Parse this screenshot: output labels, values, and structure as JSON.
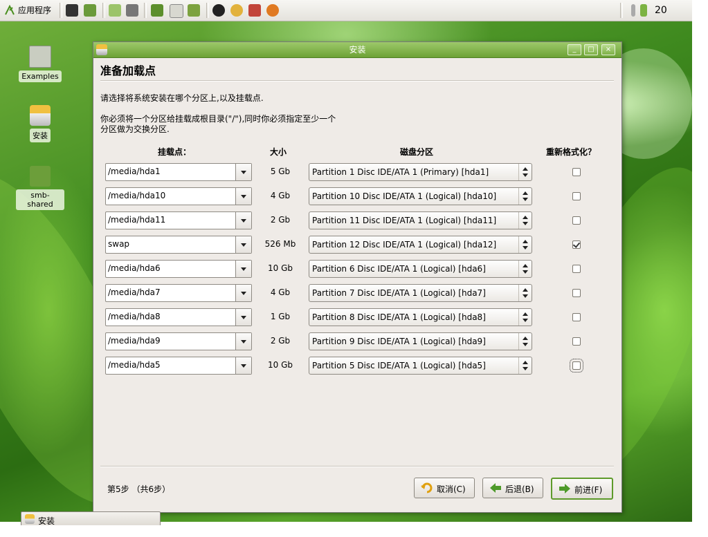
{
  "panel": {
    "apps_label": "应用程序",
    "clock": "20",
    "icons": [
      "terminal-icon",
      "folder-icon",
      "music-icon",
      "printer-icon",
      "network-icon",
      "editor-icon",
      "book-icon",
      "qq-icon",
      "chat-icon",
      "star-icon",
      "firefox-icon"
    ]
  },
  "desktop": {
    "icons": [
      {
        "label": "Examples"
      },
      {
        "label": "安装"
      },
      {
        "label": "smb-shared"
      }
    ]
  },
  "window": {
    "title": "安装",
    "heading": "准备加载点",
    "intro": "请选择将系统安装在哪个分区上,以及挂载点.",
    "note_line1": "你必须将一个分区给挂载成根目录(\"/\"),同时你必须指定至少一个",
    "note_line2": "分区做为交换分区.",
    "columns": {
      "mount": "挂载点：",
      "size": "大小",
      "partition": "磁盘分区",
      "reformat": "重新格式化？"
    },
    "rows": [
      {
        "mount": "/media/hda1",
        "size": "5 Gb",
        "partition": "Partition 1 Disc IDE/ATA 1 (Primary) [hda1]",
        "reformat": false
      },
      {
        "mount": "/media/hda10",
        "size": "4 Gb",
        "partition": "Partition 10 Disc IDE/ATA 1 (Logical) [hda10]",
        "reformat": false
      },
      {
        "mount": "/media/hda11",
        "size": "2 Gb",
        "partition": "Partition 11 Disc IDE/ATA 1 (Logical) [hda11]",
        "reformat": false
      },
      {
        "mount": "swap",
        "size": "526 Mb",
        "partition": "Partition 12 Disc IDE/ATA 1 (Logical) [hda12]",
        "reformat": true
      },
      {
        "mount": "/media/hda6",
        "size": "10 Gb",
        "partition": "Partition 6 Disc IDE/ATA 1 (Logical) [hda6]",
        "reformat": false
      },
      {
        "mount": "/media/hda7",
        "size": "4 Gb",
        "partition": "Partition 7 Disc IDE/ATA 1 (Logical) [hda7]",
        "reformat": false
      },
      {
        "mount": "/media/hda8",
        "size": "1 Gb",
        "partition": "Partition 8 Disc IDE/ATA 1 (Logical) [hda8]",
        "reformat": false
      },
      {
        "mount": "/media/hda9",
        "size": "2 Gb",
        "partition": "Partition 9 Disc IDE/ATA 1 (Logical) [hda9]",
        "reformat": false
      },
      {
        "mount": "/media/hda5",
        "size": "10 Gb",
        "partition": "Partition 5 Disc IDE/ATA 1 (Logical) [hda5]",
        "reformat": false
      }
    ],
    "step": "第5步 （共6步）",
    "buttons": {
      "cancel": "取消(C)",
      "back": "后退(B)",
      "forward": "前进(F)"
    }
  },
  "taskbar": {
    "item": "安装"
  },
  "colors": {
    "titlebar": "#7fb048",
    "accent": "#5d9a2a",
    "dialog_bg": "#efebe7"
  }
}
